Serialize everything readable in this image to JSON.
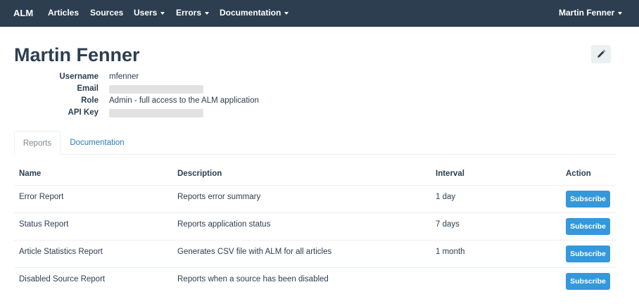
{
  "nav": {
    "brand": "ALM",
    "items": [
      {
        "label": "Articles",
        "dropdown": false
      },
      {
        "label": "Sources",
        "dropdown": false
      },
      {
        "label": "Users",
        "dropdown": true
      },
      {
        "label": "Errors",
        "dropdown": true
      },
      {
        "label": "Documentation",
        "dropdown": true
      }
    ],
    "user_menu": "Martin Fenner"
  },
  "profile": {
    "title": "Martin Fenner",
    "edit_icon": "pencil-icon",
    "fields": [
      {
        "label": "Username",
        "value": "mfenner"
      },
      {
        "label": "Email",
        "value": null
      },
      {
        "label": "Role",
        "value": "Admin - full access to the ALM application"
      },
      {
        "label": "API Key",
        "value": null
      }
    ]
  },
  "tabs": [
    {
      "label": "Reports",
      "active": true
    },
    {
      "label": "Documentation",
      "active": false
    }
  ],
  "table": {
    "columns": [
      "Name",
      "Description",
      "Interval",
      "Action"
    ],
    "rows": [
      {
        "name": "Error Report",
        "description": "Reports error summary",
        "interval": "1 day",
        "action": "Subscribe"
      },
      {
        "name": "Status Report",
        "description": "Reports application status",
        "interval": "7 days",
        "action": "Subscribe"
      },
      {
        "name": "Article Statistics Report",
        "description": "Generates CSV file with ALM for all articles",
        "interval": "1 month",
        "action": "Subscribe"
      },
      {
        "name": "Disabled Source Report",
        "description": "Reports when a source has been disabled",
        "interval": "",
        "action": "Subscribe"
      }
    ]
  },
  "colors": {
    "navbar_bg": "#2c3e50",
    "text": "#2c3e50",
    "link": "#2c7bbd",
    "button_primary": "#3498db",
    "edit_button_bg": "#ecf0f1"
  }
}
